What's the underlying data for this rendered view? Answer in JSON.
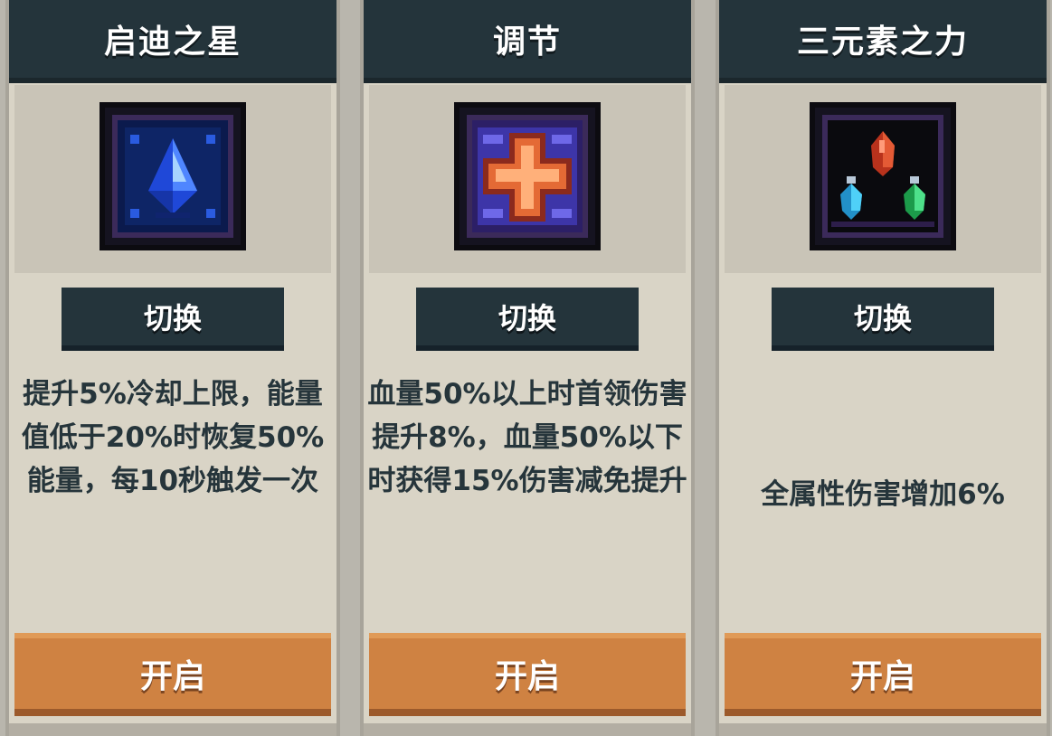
{
  "cards": [
    {
      "title": "启迪之星",
      "icon": "blue-crystal-icon",
      "switch_label": "切换",
      "description": "提升5%冷却上限，能量值低于20%时恢复50%能量，每10秒触发一次",
      "open_label": "开启"
    },
    {
      "title": "调节",
      "icon": "orange-cross-icon",
      "switch_label": "切换",
      "description": "血量50%以上时首领伤害提升8%，血量50%以下时获得15%伤害减免提升",
      "open_label": "开启"
    },
    {
      "title": "三元素之力",
      "icon": "three-elements-crystal-icon",
      "switch_label": "切换",
      "description": "全属性伤害增加6%",
      "open_label": "开启"
    }
  ],
  "colors": {
    "header": "#24343b",
    "card": "#d9d4c6",
    "button_open": "#cf8242",
    "text": "#26353b"
  }
}
